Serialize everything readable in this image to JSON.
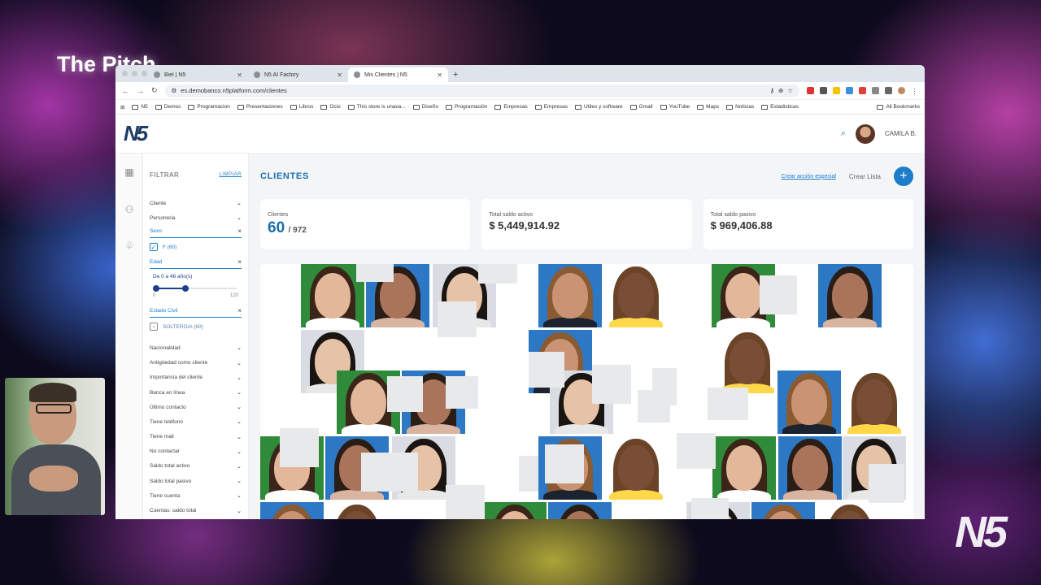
{
  "overlay": {
    "title": "The Pitch",
    "brand": "N5"
  },
  "browser": {
    "tabs": [
      {
        "label": "Biel | N5"
      },
      {
        "label": "N5 AI Factory"
      },
      {
        "label": "Mis Clientes | N5"
      }
    ],
    "new_tab": "+",
    "url": "es.demobanco.n5platform.com/clientes",
    "bookmarks": [
      "N5",
      "Demos",
      "Programacion",
      "Presentaciones",
      "Libros",
      "Ocio",
      "This store is unava...",
      "Diseño",
      "Programación",
      "Empresas",
      "Empresas",
      "Utiles y software",
      "Gmail",
      "YouTube",
      "Maps",
      "Noticias",
      "Estadisticas"
    ],
    "all_bookmarks": "All Bookmarks"
  },
  "app": {
    "logo": "N5",
    "user": "CAMILA B.",
    "filters": {
      "title": "FILTRAR",
      "clear": "LIMPIAR",
      "top": [
        "Cliente",
        "Personeria"
      ],
      "sexo": {
        "label": "Sexo",
        "option": "F (60)"
      },
      "edad": {
        "label": "Edad",
        "range": "De 0 a 46 año(s)",
        "min": "0",
        "max": "120",
        "value_fraction": 0.38
      },
      "estado": {
        "label": "Estado Civil",
        "option": "SOLTERO/A (60)"
      },
      "rest": [
        "Nacionalidad",
        "Antigüedad como cliente",
        "Importancia del cliente",
        "Banca en línea",
        "Último contacto",
        "Tiene teléfono",
        "Tiene mail",
        "No contactar",
        "Saldo total activo",
        "Saldo total pasivo",
        "Tiene cuenta",
        "Cuentas: saldo total"
      ]
    },
    "main": {
      "title": "CLIENTES",
      "special": "Crear acción especial",
      "crear_lista": "Crear Lista",
      "cards": {
        "clientes_label": "Clientes",
        "clientes_value": "60",
        "clientes_total": "/ 972",
        "activo_label": "Total saldo activo",
        "activo_value": "$ 5,449,914.92",
        "pasivo_label": "Total saldo pasivo",
        "pasivo_value": "$ 969,406.88"
      }
    }
  }
}
